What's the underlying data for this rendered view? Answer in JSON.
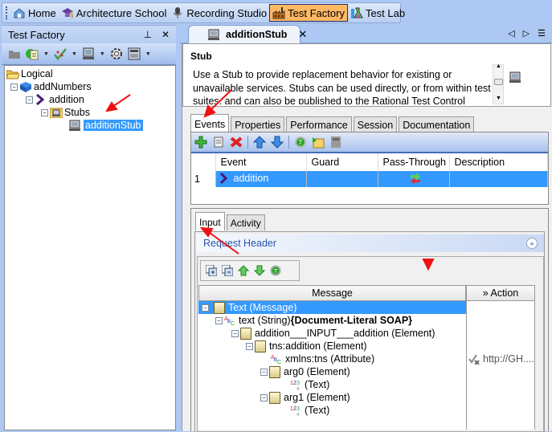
{
  "perspectives": [
    {
      "label": "Home",
      "icon": "home-icon",
      "active": false
    },
    {
      "label": "Architecture School",
      "icon": "graduation-cap-icon",
      "active": false
    },
    {
      "label": "Recording Studio",
      "icon": "microphone-icon",
      "active": false
    },
    {
      "label": "Test Factory",
      "icon": "factory-icon",
      "active": true
    },
    {
      "label": "Test Lab",
      "icon": "flask-icon",
      "active": false
    }
  ],
  "left_panel": {
    "title": "Test Factory",
    "pin_glyph": "⊥",
    "close_glyph": "✕",
    "toolbar": [
      "folder-icon",
      "new-document-icon",
      "checkmark-icon",
      "computer-icon",
      "gear-icon",
      "calculator-icon"
    ],
    "tree": [
      {
        "label": "Logical",
        "icon": "folder-open-icon",
        "level": 0
      },
      {
        "label": "addNumbers",
        "icon": "book-icon",
        "level": 1,
        "expanded": true
      },
      {
        "label": "addition",
        "icon": "operation-chevron-icon",
        "level": 2,
        "expanded": true
      },
      {
        "label": "Stubs",
        "icon": "stubs-folder-icon",
        "level": 3,
        "expanded": true
      },
      {
        "label": "additionStub",
        "icon": "computer-icon",
        "level": 4,
        "selected": true
      }
    ]
  },
  "editor": {
    "tab_label": "additionStub",
    "close_glyph": "✕",
    "nav": [
      "◁",
      "▷",
      "☰"
    ],
    "stub_title": "Stub",
    "stub_description": "Use a Stub to provide replacement behavior for existing or unavailable services. Stubs can be used directly, or from within test suites, and can also be published to the Rational Test Control",
    "tabs": [
      "Events",
      "Properties",
      "Performance",
      "Session",
      "Documentation"
    ],
    "active_tab": "Events",
    "events_toolbar": [
      "add-icon",
      "copy-icon",
      "delete-icon",
      "move-up-icon",
      "move-down-icon",
      "test-icon",
      "folder-import-icon",
      "calculator-icon"
    ],
    "events_table": {
      "columns": [
        "",
        "Event",
        "Guard",
        "Pass-Through",
        "Description"
      ],
      "rows": [
        {
          "num": "1",
          "event": "addition",
          "guard": "",
          "pass_through": "pass-through-icon",
          "description": ""
        }
      ]
    },
    "sub_tabs": [
      "Input",
      "Activity"
    ],
    "active_sub_tab": "Input",
    "request_header_label": "Request Header",
    "request_header_toggle": "»",
    "message_toolbar": [
      "expand-all-icon",
      "collapse-all-icon",
      "move-up-icon",
      "move-down-icon",
      "test-icon"
    ],
    "message_columns": {
      "message": "Message",
      "action": "Action",
      "action_glyph": "»"
    },
    "message_tree": [
      {
        "label": "Text (Message)",
        "bold_suffix": "",
        "icon": "document-icon",
        "level": 0,
        "selected": true,
        "action": ""
      },
      {
        "label": "text (String) ",
        "bold_suffix": "{Document-Literal SOAP}",
        "icon": "string-abc-icon",
        "level": 1,
        "action": ""
      },
      {
        "label": "addition___INPUT___addition (Element)",
        "bold_suffix": "",
        "icon": "document-icon",
        "level": 2,
        "action": ""
      },
      {
        "label": "tns:addition (Element)",
        "bold_suffix": "",
        "icon": "document-icon",
        "level": 3,
        "action": ""
      },
      {
        "label": "xmlns:tns (Attribute)",
        "bold_suffix": "",
        "icon": "string-abc-icon",
        "level": 4,
        "action": "http://GH...."
      },
      {
        "label": "arg0 (Element)",
        "bold_suffix": "",
        "icon": "document-icon",
        "level": 4,
        "action": ""
      },
      {
        "label": "(Text)",
        "bold_suffix": "",
        "icon": "number-1234-icon",
        "level": 5,
        "action": ""
      },
      {
        "label": "arg1 (Element)",
        "bold_suffix": "",
        "icon": "document-icon",
        "level": 4,
        "action": ""
      },
      {
        "label": "(Text)",
        "bold_suffix": "",
        "icon": "number-1234-icon",
        "level": 5,
        "action": ""
      }
    ]
  },
  "colors": {
    "selection": "#3399ff",
    "active_perspective": "#ffb864",
    "chrome_blue": "#adc8f2",
    "annotation_red": "#ee1111"
  }
}
